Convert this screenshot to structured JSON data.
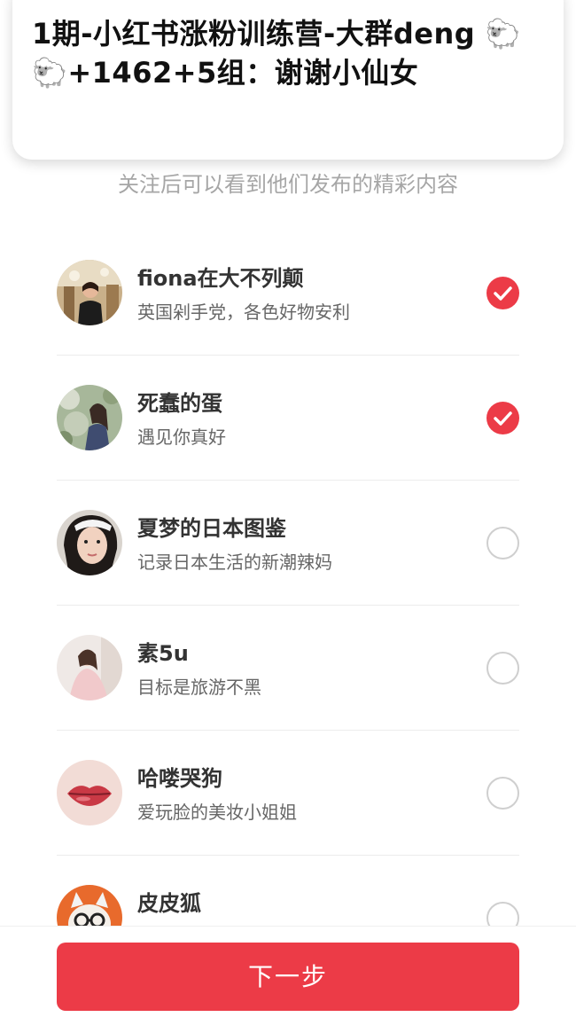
{
  "notification": {
    "text": "1期-小红书涨粉训练营-大群deng 🐑🐑+1462+5组：谢谢小仙女"
  },
  "subtitle": "关注后可以看到他们发布的精彩内容",
  "users": [
    {
      "name": "fiona在大不列颠",
      "desc": "英国剁手党，各色好物安利",
      "selected": true,
      "avatar": "woman-portrait-avatar"
    },
    {
      "name": "死蠢的蛋",
      "desc": "遇见你真好",
      "selected": true,
      "avatar": "woman-garden-avatar"
    },
    {
      "name": "夏梦的日本图鉴",
      "desc": "记录日本生活的新潮辣妈",
      "selected": false,
      "avatar": "woman-selfie-avatar"
    },
    {
      "name": "素5u",
      "desc": "目标是旅游不黑",
      "selected": false,
      "avatar": "woman-pink-dress-avatar"
    },
    {
      "name": "哈喽哭狗",
      "desc": "爱玩脸的美妆小姐姐",
      "selected": false,
      "avatar": "lips-avatar"
    },
    {
      "name": "皮皮狐",
      "desc": "",
      "selected": false,
      "avatar": "cartoon-fox-avatar"
    }
  ],
  "next_button": "下一步",
  "colors": {
    "accent": "#ec3b47",
    "text": "#333333",
    "muted": "#a6a6a6"
  }
}
